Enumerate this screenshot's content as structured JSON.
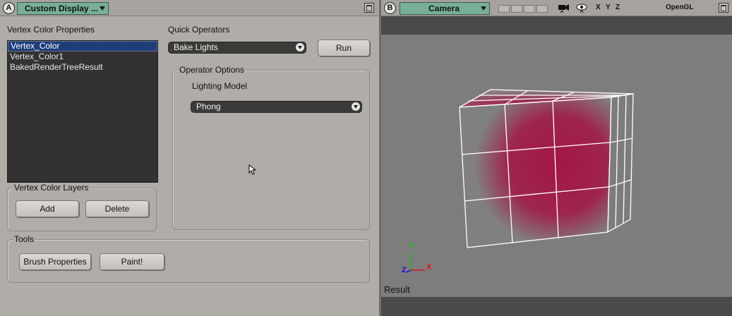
{
  "pane_a": {
    "badge": "A",
    "view_selector": "Custom Display ...",
    "vertex_color_properties_label": "Vertex Color Properties",
    "vertex_color_list": [
      "Vertex_Color",
      "Vertex_Color1",
      "BakedRenderTreeResult"
    ],
    "selected_index": 0,
    "vertex_color_layers_title": "Vertex Color Layers",
    "add_label": "Add",
    "delete_label": "Delete",
    "tools_title": "Tools",
    "brush_properties_label": "Brush Properties",
    "paint_label": "Paint!",
    "quick_operators_label": "Quick Operators",
    "quick_operator_value": "Bake Lights",
    "run_label": "Run",
    "operator_options_title": "Operator Options",
    "lighting_model_label": "Lighting Model",
    "lighting_model_value": "Phong"
  },
  "pane_b": {
    "badge": "B",
    "camera_selector": "Camera",
    "axes_toggle": [
      "X",
      "Y",
      "Z"
    ],
    "display_mode": "OpenGL",
    "viewport_caption": "Result",
    "axis_gizmo": {
      "x": "X",
      "y": "Y",
      "z": "Z"
    }
  },
  "colors": {
    "pane_bg": "#b0aca7",
    "selector_green": "#78b097",
    "list_bg": "#333131",
    "selection_blue": "#1f3d7a",
    "viewport_bg": "#7d7d7d",
    "vertex_color_red": "#a31545",
    "axis_x": "#e01010",
    "axis_y": "#10c010",
    "axis_z": "#1010e0"
  }
}
